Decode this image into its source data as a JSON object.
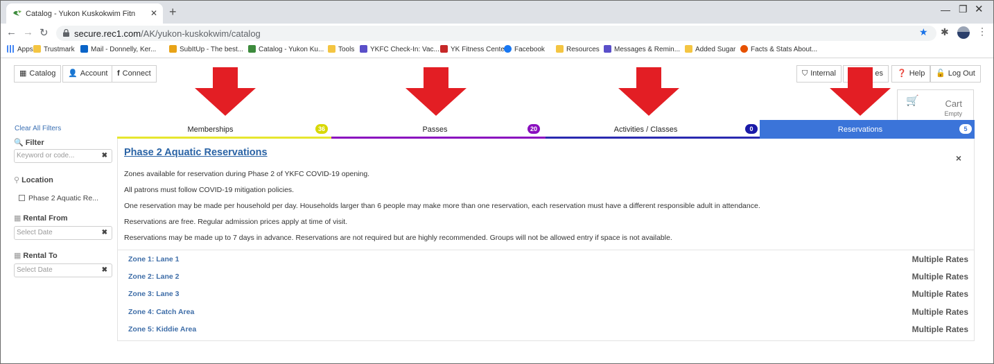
{
  "browser": {
    "tab_title": "Catalog - Yukon Kuskokwim Fitn",
    "url_domain": "secure.rec1.com",
    "url_path": "/AK/yukon-kuskokwim/catalog",
    "bookmarks": [
      {
        "label": "Apps",
        "color": "#4285f4"
      },
      {
        "label": "Trustmark",
        "color": "#f4c542"
      },
      {
        "label": "Mail - Donnelly, Ker...",
        "color": "#0a64c8"
      },
      {
        "label": "SubItUp - The best...",
        "color": "#e8a317"
      },
      {
        "label": "Catalog - Yukon Ku...",
        "color": "#3d8b3d"
      },
      {
        "label": "Tools",
        "color": "#f4c542"
      },
      {
        "label": "YKFC Check-In: Vac...",
        "color": "#5a4fc9"
      },
      {
        "label": "YK Fitness Center",
        "color": "#c62828"
      },
      {
        "label": "Facebook",
        "color": "#1877f2"
      },
      {
        "label": "Resources",
        "color": "#f4c542"
      },
      {
        "label": "Messages & Remin...",
        "color": "#5a4fc9"
      },
      {
        "label": "Added Sugar",
        "color": "#f4c542"
      },
      {
        "label": "Facts & Stats About...",
        "color": "#e65100"
      }
    ]
  },
  "topnav": {
    "catalog": "Catalog",
    "account": "Account",
    "connect": "Connect",
    "internal": "Internal",
    "notes_fragment": "es",
    "help": "Help",
    "logout": "Log Out"
  },
  "cart": {
    "label": "Cart",
    "status": "Empty"
  },
  "tabs": [
    {
      "label": "Memberships",
      "count": "36",
      "color": "#e6e62e"
    },
    {
      "label": "Passes",
      "count": "20",
      "color": "#8a0fbf"
    },
    {
      "label": "Activities / Classes",
      "count": "0",
      "color": "#2a2ab0"
    },
    {
      "label": "Reservations",
      "count": "5",
      "color": "#3b74d9"
    }
  ],
  "sidebar": {
    "clear_filters": "Clear All Filters",
    "filter_heading": "Filter",
    "filter_placeholder": "Keyword or code...",
    "location_heading": "Location",
    "location_option": "Phase 2 Aquatic Re...",
    "rental_from_heading": "Rental From",
    "rental_from_placeholder": "Select Date",
    "rental_to_heading": "Rental To",
    "rental_to_placeholder": "Select Date"
  },
  "content": {
    "title": "Phase 2 Aquatic Reservations",
    "description": [
      "Zones available for reservation during Phase 2 of YKFC COVID-19 opening.",
      "All patrons must follow COVID-19 mitigation policies.",
      "One reservation may be made per household per day. Households larger than 6 people may make more than one reservation, each reservation must have a different responsible adult in attendance.",
      "Reservations are free. Regular admission prices apply at time of visit.",
      "Reservations may be made up to 7 days in advance. Reservations are not required but are highly recommended. Groups will not be allowed entry if space is not available."
    ],
    "zones": [
      {
        "name": "Zone 1: Lane 1",
        "rate": "Multiple Rates"
      },
      {
        "name": "Zone 2: Lane 2",
        "rate": "Multiple Rates"
      },
      {
        "name": "Zone 3: Lane 3",
        "rate": "Multiple Rates"
      },
      {
        "name": "Zone 4: Catch Area",
        "rate": "Multiple Rates"
      },
      {
        "name": "Zone 5: Kiddie Area",
        "rate": "Multiple Rates"
      }
    ]
  },
  "colors": {
    "arrow": "#e31e24",
    "active_tab": "#3b74d9",
    "link": "#2a63a5"
  }
}
